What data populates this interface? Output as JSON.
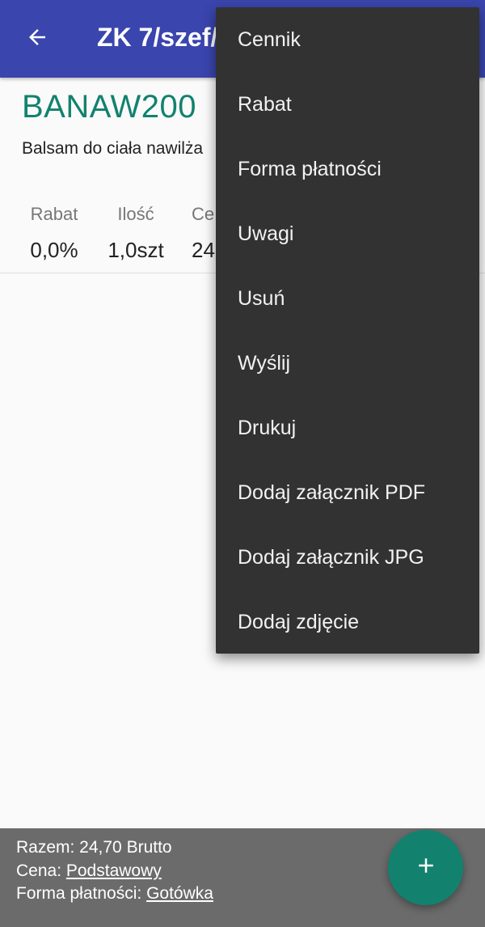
{
  "appbar": {
    "title": "ZK 7/szef/",
    "back_icon": "arrow-left-icon",
    "color": "#3a45ad"
  },
  "product": {
    "code": "BANAW200",
    "description": "Balsam do ciała nawilża",
    "code_color": "#12826f"
  },
  "columns": [
    {
      "header": "Rabat",
      "value": "0,0%"
    },
    {
      "header": "Ilość",
      "value": "1,0szt"
    },
    {
      "header": "Ce",
      "value": "24"
    }
  ],
  "menu": {
    "items": [
      "Cennik",
      "Rabat",
      "Forma płatności",
      "Uwagi",
      "Usuń",
      "Wyślij",
      "Drukuj",
      "Dodaj załącznik PDF",
      "Dodaj załącznik JPG",
      "Dodaj zdjęcie"
    ]
  },
  "footer": {
    "total": "Razem: 24,70 Brutto",
    "price_label": "Cena: ",
    "price_value": "Podstawowy",
    "payment_label": "Forma płatności: ",
    "payment_value": "Gotówka"
  },
  "fab": {
    "icon": "plus-icon",
    "color": "#12826f"
  }
}
